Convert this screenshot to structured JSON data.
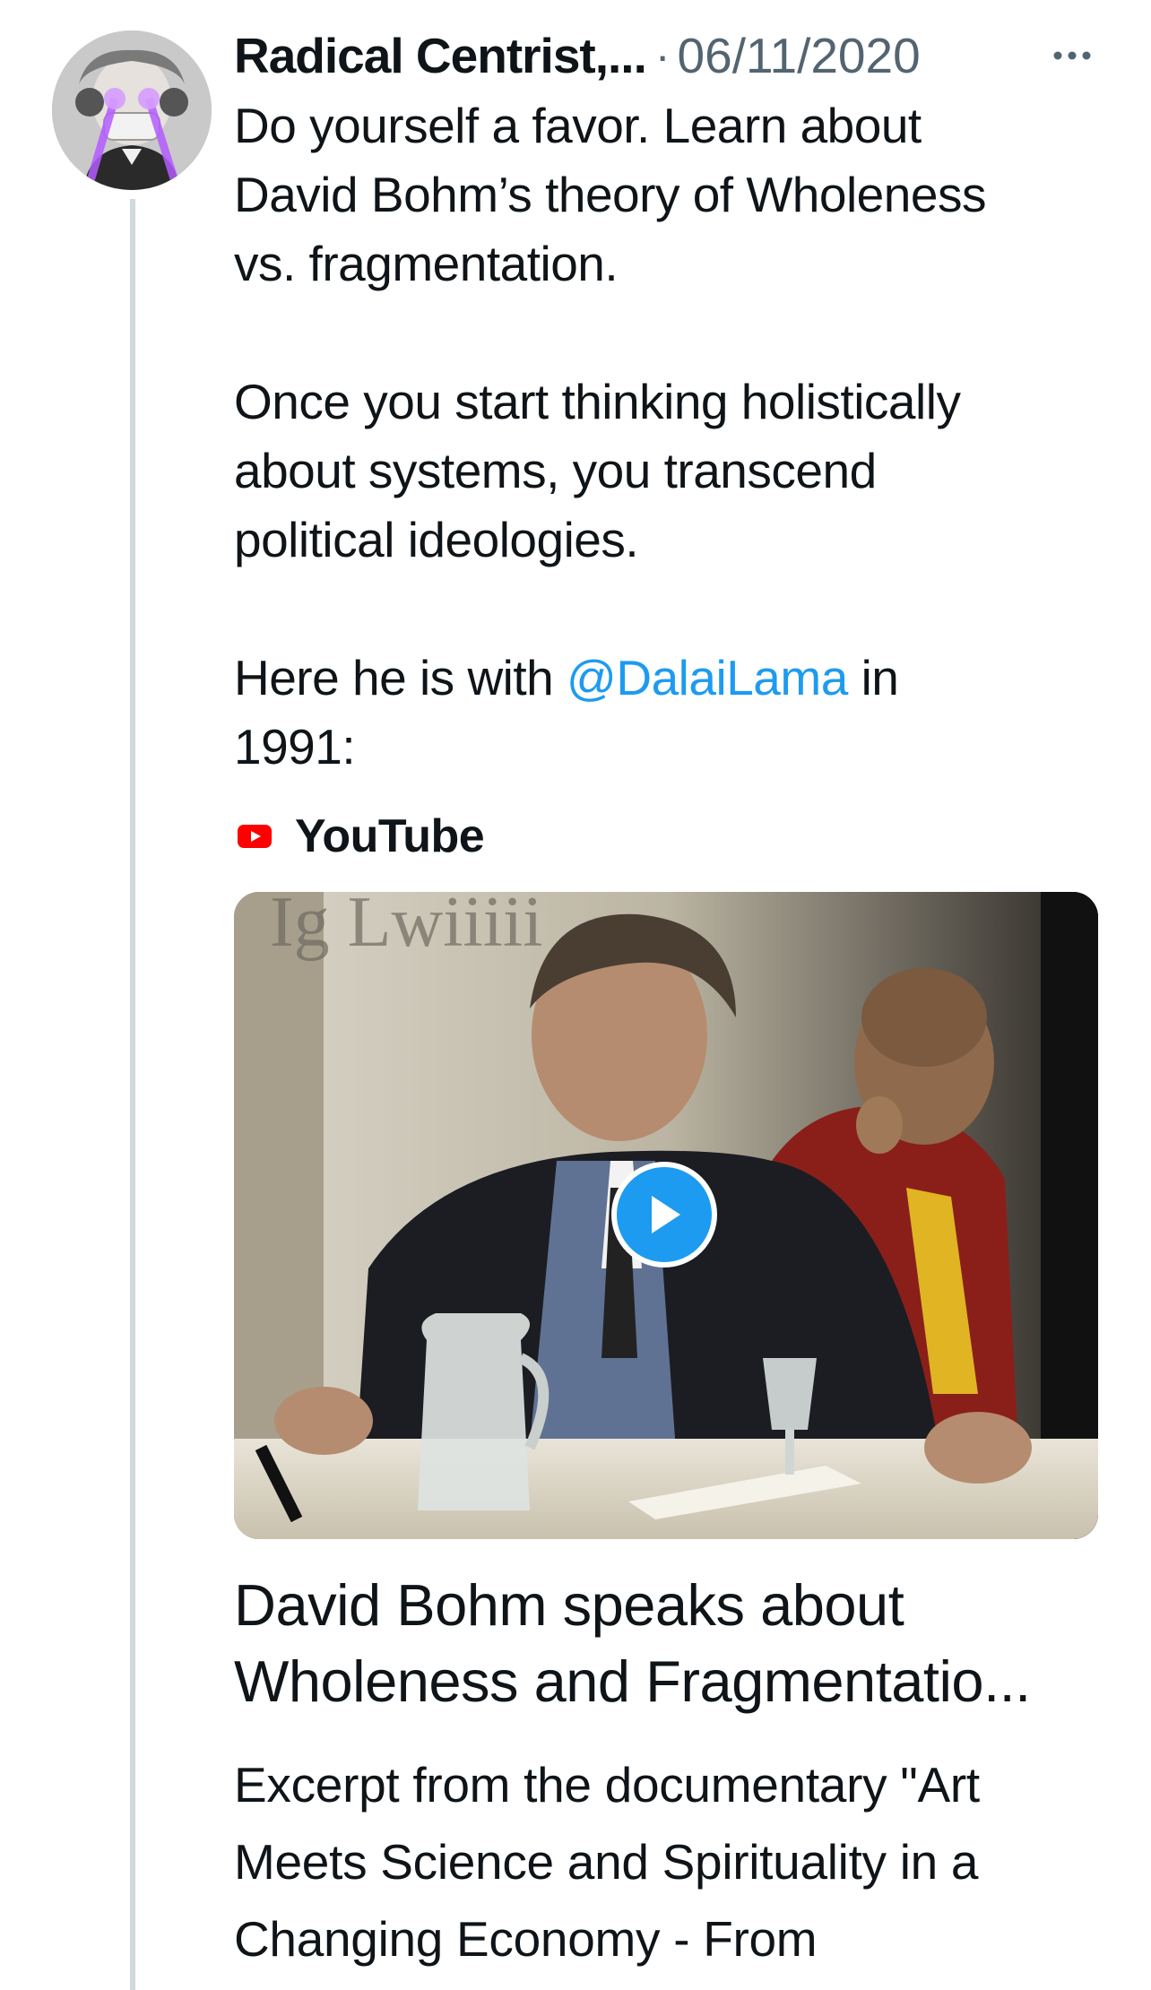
{
  "tweet": {
    "author_name": "Radical Centrist,...",
    "separator": "·",
    "date": "06/11/2020",
    "more_icon": "more-horizontal-icon",
    "text_part1": "Do yourself a favor. Learn about\nDavid Bohm’s theory of Wholeness\nvs. fragmentation.\n\nOnce you start thinking holistically\nabout systems, you transcend\npolitical ideologies.\n\nHere he is with ",
    "mention": "@DalaiLama",
    "text_part2": " in\n1991:"
  },
  "card": {
    "source_icon": "youtube-icon",
    "source_name": "YouTube",
    "play_icon": "play-icon",
    "title_line1": "David Bohm speaks about",
    "title_line2": "Wholeness and Fragmentatio...",
    "description_line1": "Excerpt from the documentary \"Art",
    "description_line2": "Meets Science and Spirituality in a",
    "description_line3": "Changing Economy - From"
  },
  "colors": {
    "link": "#1d9bf0",
    "text": "#0f1419",
    "secondary": "#536471",
    "thread_line": "#cfd9de",
    "youtube_red": "#ff0000"
  }
}
